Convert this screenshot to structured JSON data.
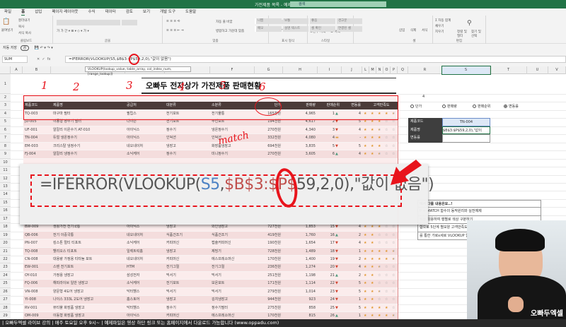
{
  "window": {
    "title": "가전제품 목록 - 예제파일 ▾",
    "search_placeholder": "검색"
  },
  "menu": [
    "파일",
    "홈",
    "삽입",
    "페이지 레이아웃",
    "수식",
    "데이터",
    "검토",
    "보기",
    "개발 도구",
    "도움말"
  ],
  "ribbon": {
    "clipboard": {
      "label": "클립보드",
      "paste": "붙여넣기",
      "cut": "잘라내기",
      "copy": "복사",
      "format_painter": "서식 복사"
    },
    "font": {
      "label": "글꼴"
    },
    "alignment": {
      "label": "맞춤",
      "wrap": "자동 줄 바꿈",
      "merge": "병합하고 가운데 맞춤"
    },
    "number": {
      "label": "표시 형식",
      "format": "일반"
    },
    "styles": {
      "label": "스타일",
      "conditional": "조건부 서식",
      "table": "표 서식",
      "cells": [
        "표준",
        "나쁨",
        "보통",
        "좋음",
        "경고문",
        "계산",
        "메모",
        "설명 텍스트",
        "셀 확인",
        "연결된 셀"
      ]
    },
    "cells": {
      "label": "셀",
      "insert": "삽입",
      "delete": "삭제",
      "format": "서식"
    },
    "editing": {
      "label": "편집",
      "autosum": "Σ 자동 합계",
      "fill": "채우기",
      "clear": "지우기",
      "sort": "정렬 및 필터",
      "find": "찾기 및 선택"
    }
  },
  "qat": {
    "autosave": "자동 저장",
    "toggle": "끔"
  },
  "formula_bar": {
    "name_box": "SUM",
    "formula": "=IFERROR(VLOOKUP(S5,$B$3:$P$59,2,0),\"값이 없음\")",
    "tooltip": "VLOOKUP(lookup_value, table_array, col_index_num, [range_lookup])"
  },
  "columns": [
    "A",
    "B",
    "C",
    "D",
    "E",
    "F",
    "G",
    "H",
    "I",
    "J",
    "L",
    "M",
    "N",
    "O",
    "P",
    "Q",
    "R",
    "S",
    "T",
    "U",
    "V"
  ],
  "sheet": {
    "title": "오빠두 전자상가 가전제품 판매현황",
    "headers": [
      "제품코드",
      "제품명",
      "공급처",
      "대분류",
      "소분류",
      "단가",
      "판매량",
      "판매순위",
      "변동률",
      "고객만족도"
    ],
    "rows": [
      {
        "r": 4,
        "code": "TQ-003",
        "name": "마구마 필터",
        "supplier": "필립스",
        "cat": "전기포트",
        "sub": "전기물통",
        "price": "165천원",
        "qty": "4,965",
        "rank": "1",
        "trend": "up",
        "change": "4",
        "stars": 4.5
      },
      {
        "r": 5,
        "code": "JD-005",
        "name": "이동형 정수기 필터",
        "supplier": "다이슨",
        "cat": "전기포트",
        "sub": "무선포트",
        "price": "194천원",
        "qty": "4,617",
        "rank": "2",
        "trend": "down",
        "change": "5",
        "stars": 3
      },
      {
        "r": 6,
        "code": "UF-001",
        "name": "알칼리 이온수기 AT-010",
        "supplier": "아이닉스",
        "cat": "정수기",
        "sub": "냉온정수기",
        "price": "270천원",
        "qty": "4,340",
        "rank": "3",
        "trend": "down",
        "change": "4",
        "stars": 2.5
      },
      {
        "r": 7,
        "code": "TN-004",
        "name": "듀얼 냉온정수기",
        "supplier": "아이닉스",
        "cat": "인덕션",
        "sub": "인덕션",
        "price": "332천원",
        "qty": "4,080",
        "rank": "4",
        "trend": "flat",
        "change": "-",
        "stars": 3
      },
      {
        "r": 8,
        "code": "EM-003",
        "name": "크리스탈 냉정수기",
        "supplier": "네오네이처",
        "cat": "냉장고",
        "sub": "화장품냉장고",
        "price": "694천원",
        "qty": "3,835",
        "rank": "5",
        "trend": "down",
        "change": "5",
        "stars": 3
      },
      {
        "r": 9,
        "code": "FJ-004",
        "name": "알칼리 냉정수기",
        "supplier": "소닉케어",
        "cat": "정수기",
        "sub": "미니정수기",
        "price": "270천원",
        "qty": "3,605",
        "rank": "6",
        "trend": "up",
        "change": "4",
        "stars": 2.5
      },
      {
        "r": 18,
        "code": "BW-009",
        "name": "생활가전 전기국통",
        "supplier": "아이닉스",
        "cat": "냉장고",
        "sub": "와인냉장고",
        "price": "727천원",
        "qty": "1,853",
        "rank": "15",
        "trend": "down",
        "change": "4",
        "stars": 3
      },
      {
        "r": 19,
        "code": "QB-006",
        "name": "전기 이중국통",
        "supplier": "네오네이처",
        "cat": "식품건조기",
        "sub": "식품건조기",
        "price": "419천원",
        "qty": "1,760",
        "rank": "16",
        "trend": "up",
        "change": "2",
        "stars": 2
      },
      {
        "r": 20,
        "code": "PN-007",
        "name": "킹스톤 멀티 티포트",
        "supplier": "소닉케어",
        "cat": "커피머신",
        "sub": "캡슐커피머신",
        "price": "190천원",
        "qty": "1,654",
        "rank": "17",
        "trend": "down",
        "change": "4",
        "stars": 2
      },
      {
        "r": 21,
        "code": "TQ-008",
        "name": "헬리오스 티포트",
        "supplier": "일렉트릭홈",
        "cat": "냉장고",
        "sub": "제빙기",
        "price": "728천원",
        "qty": "1,489",
        "rank": "18",
        "trend": "down",
        "change": "1",
        "stars": 4.5
      },
      {
        "r": 22,
        "code": "CN-008",
        "name": "대용량 가정용 티타늄 포트",
        "supplier": "네오네이처",
        "cat": "커피머신",
        "sub": "에스프레소머신",
        "price": "170천원",
        "qty": "1,400",
        "rank": "19",
        "trend": "down",
        "change": "2",
        "stars": 4.5
      },
      {
        "r": 23,
        "code": "EW-001",
        "name": "스텐 전기포트",
        "supplier": "HTM",
        "cat": "전기그릴",
        "sub": "전기그릴",
        "price": "236천원",
        "qty": "1,274",
        "rank": "20",
        "trend": "down",
        "change": "4",
        "stars": 2.5
      },
      {
        "r": 24,
        "code": "OY-010",
        "name": "가정용 냉장고",
        "supplier": "삼성전자",
        "cat": "믹서기",
        "sub": "믹서기",
        "price": "251천원",
        "qty": "1,198",
        "rank": "21",
        "trend": "up",
        "change": "2",
        "stars": 2
      },
      {
        "r": 25,
        "code": "FQ-006",
        "name": "해피라이브 일반 냉장고",
        "supplier": "소닉케어",
        "cat": "전기포트",
        "sub": "보온포트",
        "price": "171천원",
        "qty": "1,114",
        "rank": "22",
        "trend": "down",
        "change": "5",
        "stars": 2
      },
      {
        "r": 26,
        "code": "VN-008",
        "name": "양문형 4도어 냉장고",
        "supplier": "닥터헬스",
        "cat": "믹서기",
        "sub": "믹서기",
        "price": "279천원",
        "qty": "1,014",
        "rank": "23",
        "trend": "down",
        "change": "5",
        "stars": 2.5
      },
      {
        "r": 27,
        "code": "YI-008",
        "name": "나이스 333L 2도어 냉장고",
        "supplier": "홈스토어",
        "cat": "냉장고",
        "sub": "김치냉장고",
        "price": "944천원",
        "qty": "923",
        "rank": "24",
        "trend": "down",
        "change": "1",
        "stars": 2
      },
      {
        "r": 28,
        "code": "RV-001",
        "name": "뷰티풀 화장품 냉장고",
        "supplier": "닥터헬스",
        "cat": "정수기",
        "sub": "정수기필터",
        "price": "275천원",
        "qty": "858",
        "rank": "25",
        "trend": "down",
        "change": "5",
        "stars": 4
      },
      {
        "r": 29,
        "code": "OM-009",
        "name": "이동형 화장품 냉장고",
        "supplier": "아이닉스",
        "cat": "커피머신",
        "sub": "에스프레소머신",
        "price": "170천원",
        "qty": "815",
        "rank": "26",
        "trend": "up",
        "change": "1",
        "stars": 4.5
      }
    ]
  },
  "side": {
    "cell_value": "4",
    "radios": [
      {
        "label": "단가",
        "checked": false
      },
      {
        "label": "판매량",
        "checked": false
      },
      {
        "label": "판매순위",
        "checked": false
      },
      {
        "label": "변동률",
        "checked": true
      }
    ],
    "lookup": [
      {
        "label": "제품코드",
        "value": "TN-004"
      },
      {
        "label": "제품명",
        "value": "$B$3:$P$59,2,0),\"값이"
      },
      {
        "label": "변동률",
        "value": ""
      }
    ],
    "topics": [
      "에서 다룰 내용은요..!",
      "P + MATCH 함수의 동작원리와 실전예제",
      "식을 활용하여 행별로 색상 구분하기",
      "합으로 5단계 별모양 고객만족도 표시하기",
      "를 통한 가로x세로 VLOOKUP 함수"
    ]
  },
  "annotations": {
    "numbers": [
      "1",
      "2",
      "3",
      "4",
      "5",
      "6"
    ],
    "match": "match"
  },
  "overlay": {
    "formula_parts": [
      "=IFERROR(VLOOKUP(",
      "S5",
      ",",
      "$B$3:$P$",
      "59,2,0),\"값이 없음\")"
    ]
  },
  "banner": {
    "text": "| 오빠두엑셀 라이브 강의 | 매주 토요일 오후 9시~ | 예제파일은 영상 하단 링크 또는 홈페이지에서 다운로드 가능합니다 (www.oppadu.com)",
    "logo": "오빠두엑셀"
  },
  "colors": {
    "excel_green": "#217346",
    "header_brown": "#4b3b39",
    "annotation_red": "#e8141c",
    "star": "#e0962e"
  }
}
